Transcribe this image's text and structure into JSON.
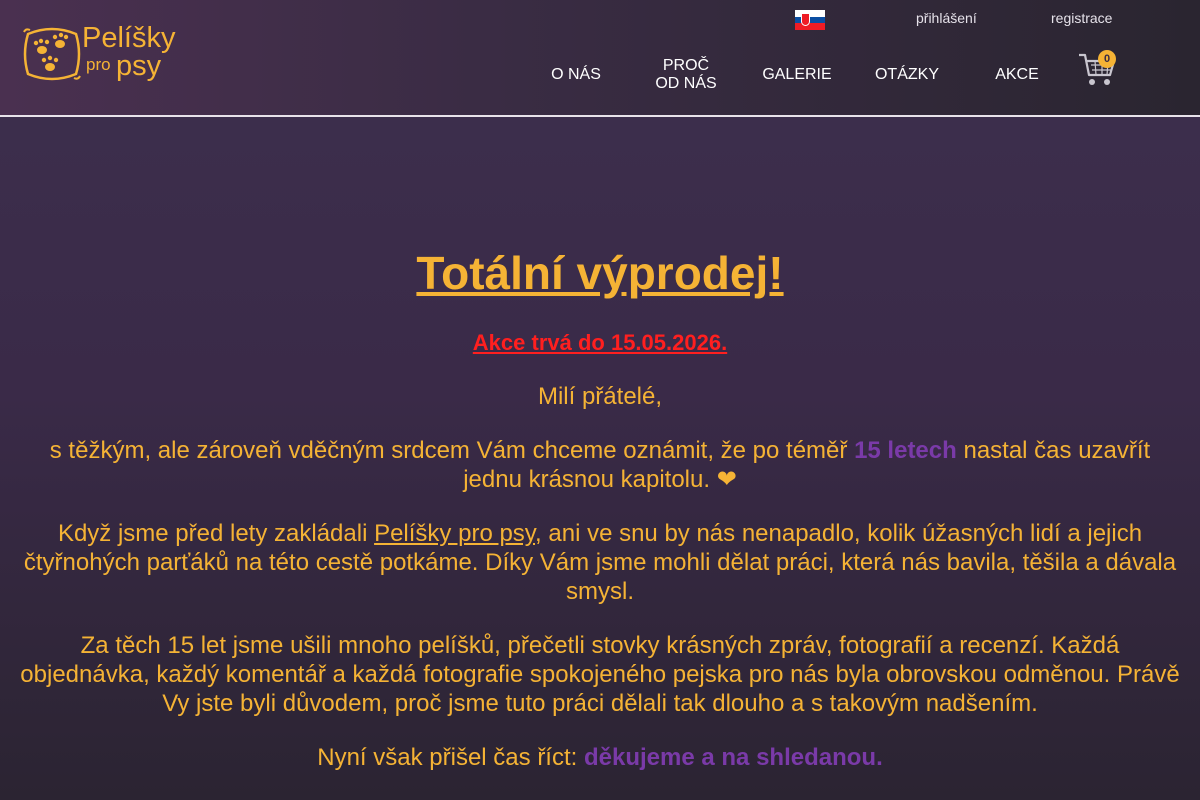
{
  "brand": {
    "logo_line1": "Pelíšky",
    "logo_line2": "pro",
    "logo_line3": "psy"
  },
  "header": {
    "language_flag": "slovakia-flag",
    "login_label": "přihlášení",
    "register_label": "registrace",
    "home_icon": "",
    "nav": [
      {
        "label": "O NÁS"
      },
      {
        "label_line1": "PROČ",
        "label_line2": "OD NÁS"
      },
      {
        "label": "GALERIE"
      },
      {
        "label": "OTÁZKY"
      },
      {
        "label": "AKCE"
      }
    ],
    "cart_count": "0"
  },
  "colors": {
    "accent": "#f5b335",
    "highlight": "#7a3aa8",
    "alert": "#ff1f1f",
    "background": "#3a2a48"
  },
  "main": {
    "title": "Totální výprodej!",
    "sale_notice": "Akce trvá do 15.05.2026.",
    "greeting": "Milí přátelé,",
    "p1": {
      "before": "s těžkým, ale zároveň vděčným srdcem Vám chceme oznámit, že po téměř ",
      "highlight": "15 letech",
      "after": " nastal čas uzavřít jednu krásnou kapitolu. ❤"
    },
    "p2": {
      "before": "Když jsme před lety zakládali ",
      "link": "Pelíšky pro psy",
      "after": ", ani ve snu by nás nenapadlo, kolik úžasných lidí a jejich čtyřnohých parťáků na této cestě potkáme. Díky Vám jsme mohli dělat práci, která nás bavila, těšila a dávala smysl."
    },
    "p3": "Za těch 15 let jsme ušili mnoho pelíšků, přečetli stovky krásných zpráv, fotografií a recenzí. Každá objednávka, každý komentář a každá fotografie spokojeného pejska pro nás byla obrovskou odměnou. Právě Vy jste byli důvodem, proč jsme tuto práci dělali tak dlouho a s takovým nadšením.",
    "p4": {
      "before": "Nyní však přišel čas říct: ",
      "highlight": "děkujeme a na shledanou."
    }
  }
}
